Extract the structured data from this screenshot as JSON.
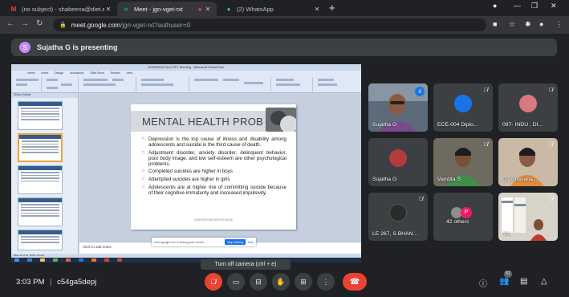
{
  "browser": {
    "tabs": [
      {
        "title": "(no subject) - shabeena@diet.e…",
        "active": false,
        "favicon": "gmail-icon",
        "color": "#ea4335"
      },
      {
        "title": "Meet - jgn-vget-rxt",
        "active": true,
        "favicon": "meet-icon",
        "color": "#00897b"
      },
      {
        "title": "(2) WhatsApp",
        "active": false,
        "favicon": "whatsapp-icon",
        "color": "#25d366"
      }
    ],
    "recording_icon": "recording-dot-icon",
    "url_host": "meet.google.com",
    "url_path": "/jgn-vget-rxt?authuser=0"
  },
  "presenting": {
    "avatar_letter": "S",
    "text": "Sujatha G is presenting"
  },
  "shared_screen": {
    "window_title": "NORMSSCHILD.PPT Meeting - Microsoft PowerPoint",
    "ribbon_tabs": [
      "Home",
      "Insert",
      "Design",
      "Animations",
      "Slide Show",
      "Review",
      "View"
    ],
    "left_tabs": "Slides   Outline",
    "slide": {
      "title": "MENTAL HEALTH PROB",
      "bullets": [
        "Depression is the top cause of illness and disability among adolescents and suicide is the third cause of death.",
        "Adjustment disorder, anxiety disorder, delinquent behavior, poor body image, and low self-esteem are other psychological problems.",
        "Completed suicides are higher in boys",
        "Attempted suicides are higher in girls",
        "Adolescents are at higher risk of committing suicide because of their cognitive immaturity and increased impulsivity."
      ],
      "footer": "GHAI 8TH EDITION PG 83-89"
    },
    "notes_placeholder": "Click to add notes",
    "share_bar_text": "meet.google.com is sharing your screen.",
    "stop_sharing": "Stop sharing",
    "hide": "Hide",
    "status_text": "Slide 11 of 33     \"Office Theme\""
  },
  "participants": [
    {
      "name": "Sujatha G",
      "speaking": true,
      "video": "woman-glasses",
      "muted": false
    },
    {
      "name": "ECE-004 Diplo...",
      "speaking": false,
      "video": "avatar-blue",
      "muted": true
    },
    {
      "name": "097- INDU , DI...",
      "speaking": false,
      "video": "avatar-pink",
      "muted": true
    },
    {
      "name": "Sujatha G",
      "speaking": false,
      "video": "avatar-red",
      "muted": false
    },
    {
      "name": "Vandita S",
      "speaking": false,
      "video": "woman-green",
      "muted": true
    },
    {
      "name": "O...Bhavana...",
      "speaking": false,
      "video": "woman-orange",
      "muted": true
    },
    {
      "name": "LE 267, S.BHAN...",
      "speaking": false,
      "video": "avatar-dark",
      "muted": true
    },
    {
      "name": "42 others",
      "speaking": false,
      "video": "others",
      "muted": false,
      "others_letter": "P"
    },
    {
      "name": "You",
      "speaking": false,
      "video": "self-room",
      "muted": true
    }
  ],
  "tooltip": "Turn off camera (ctrl + e)",
  "bottom": {
    "time": "3:03 PM",
    "separator": "|",
    "meeting_code": "c54ga5depj",
    "participant_count": "51",
    "controls": [
      "mic-off-icon",
      "camera-icon",
      "captions-icon",
      "raise-hand-icon",
      "present-icon",
      "more-icon",
      "hangup-icon"
    ],
    "right_icons": [
      "info-icon",
      "people-icon",
      "chat-icon",
      "activities-icon"
    ]
  },
  "colors": {
    "accent": "#8ab4f8",
    "hangup": "#ea4335",
    "slide_bullet": "#c0504d"
  }
}
